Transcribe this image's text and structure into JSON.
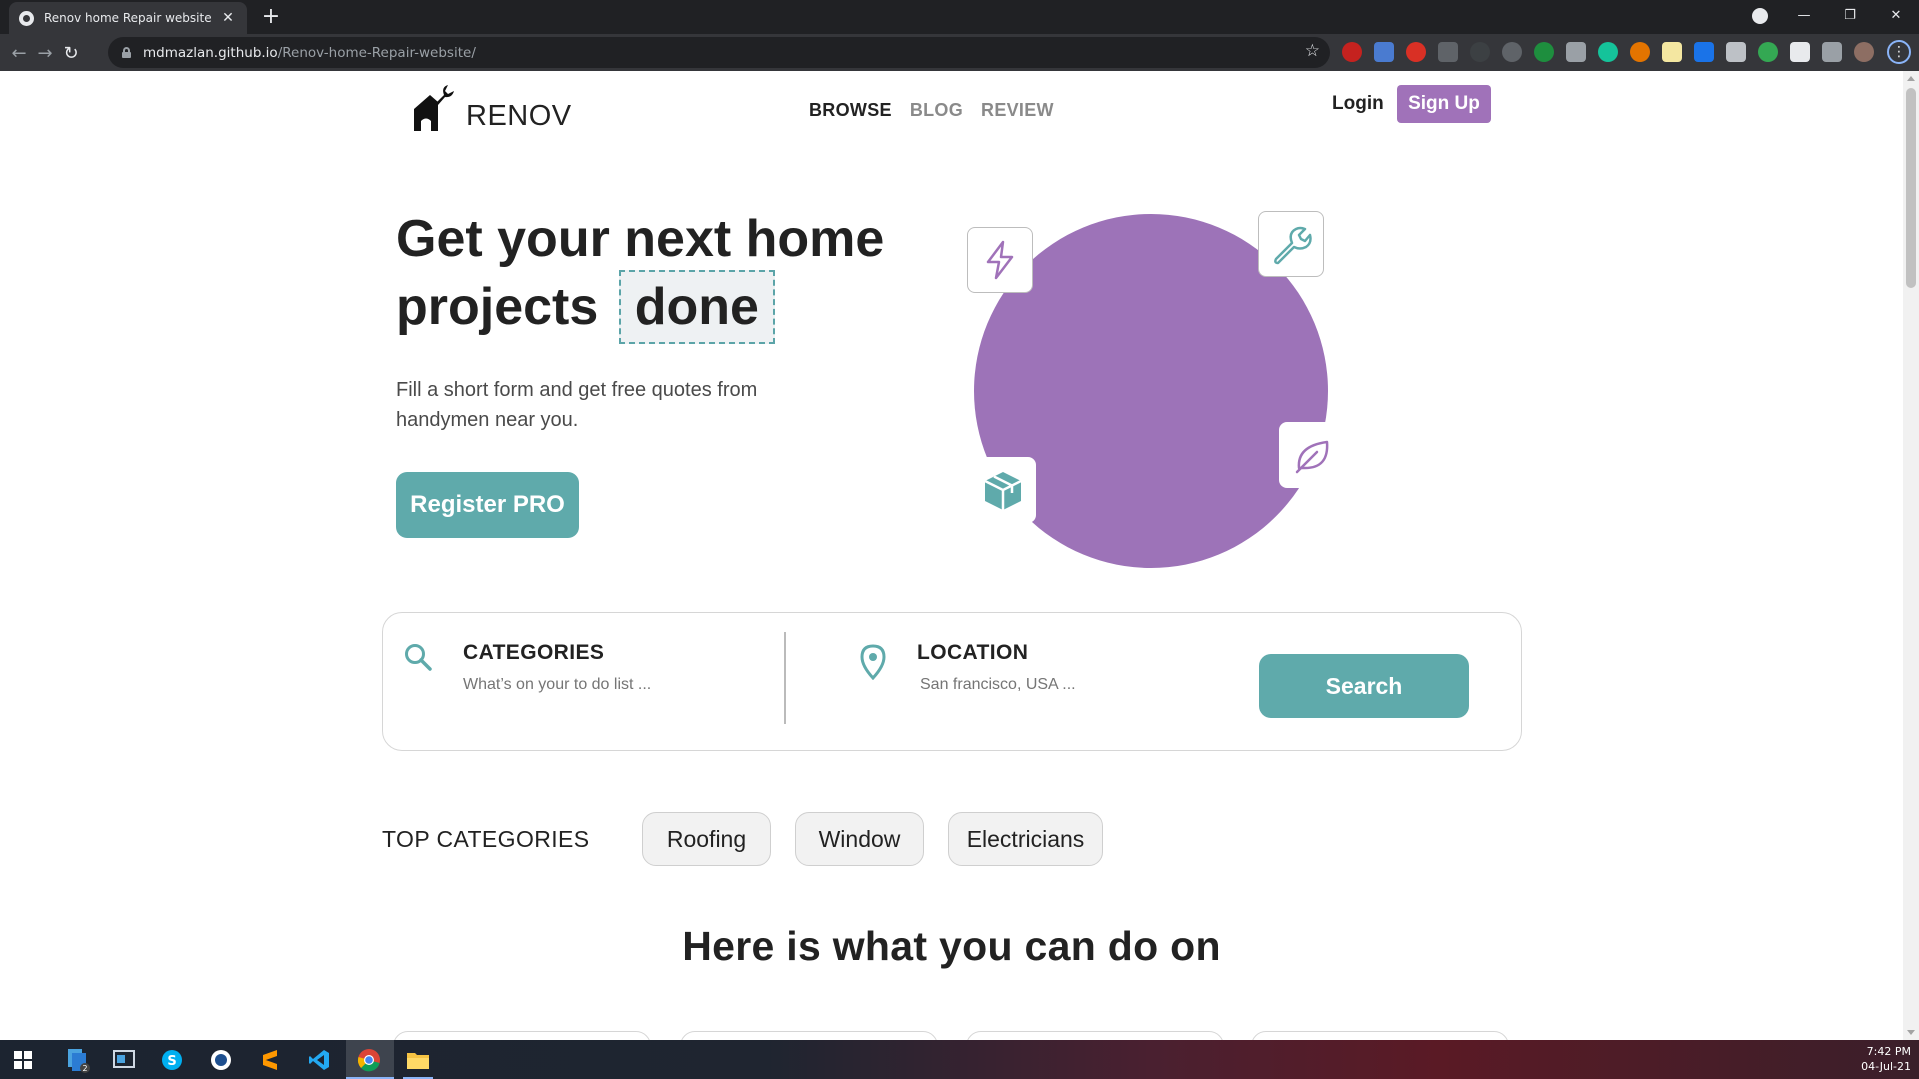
{
  "browser": {
    "tab_title": "Renov home Repair website",
    "tab_close": "✕",
    "new_tab": "+",
    "url_host": "mdmazlan.github.io",
    "url_path": "/Renov-home-Repair-website/",
    "back": "←",
    "forward": "→",
    "reload": "↻",
    "bookmark_star": "☆",
    "menu": "⋮",
    "window_controls": {
      "minimize": "—",
      "restore": "❐",
      "close": "✕"
    }
  },
  "site": {
    "brand": "RENOV",
    "nav": [
      "BROWSE",
      "BLOG",
      "REVIEW"
    ],
    "login": "Login",
    "signup": "Sign Up",
    "accent_purple": "#a072b9",
    "accent_teal": "#5faaab"
  },
  "hero": {
    "title_line1": "Get your next home",
    "title_line2_prefix": "projects",
    "title_highlight": "done",
    "subtitle": "Fill a short form and get free quotes from handymen near you.",
    "cta": "Register PRO",
    "floating_icons": [
      "lightning-icon",
      "wrench-icon",
      "leaf-icon",
      "box-icon"
    ]
  },
  "search": {
    "categories_label": "CATEGORIES",
    "categories_placeholder": "What’s on your to do list ...",
    "location_label": "LOCATION",
    "location_placeholder": "San francisco, USA ...",
    "button": "Search"
  },
  "top_categories": {
    "label": "TOP CATEGORIES",
    "chips": [
      "Roofing",
      "Window",
      "Electricians"
    ]
  },
  "section": {
    "title": "Here is what you can do on"
  },
  "taskbar": {
    "time": "7:42 PM",
    "date": "04-Jul-21",
    "badge": "2"
  }
}
